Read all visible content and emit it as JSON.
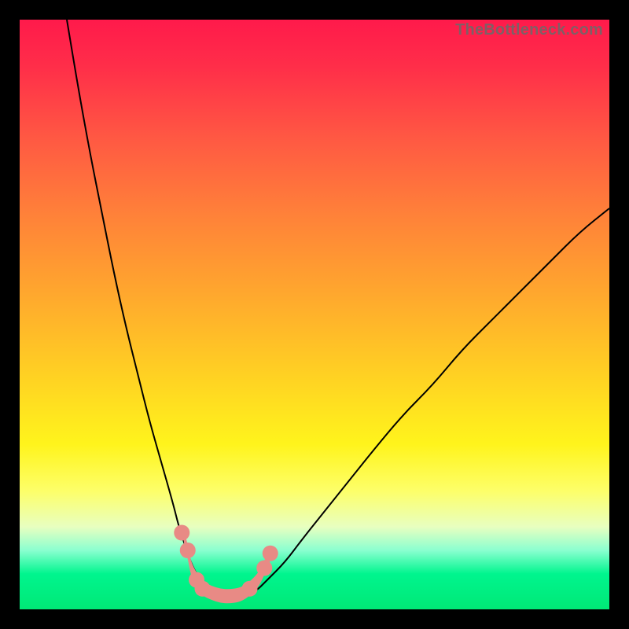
{
  "watermark": "TheBottleneck.com",
  "chart_data": {
    "type": "line",
    "title": "",
    "xlabel": "",
    "ylabel": "",
    "xlim": [
      0,
      100
    ],
    "ylim": [
      0,
      100
    ],
    "grid": false,
    "legend": false,
    "annotations": [],
    "series": [
      {
        "name": "left-curve",
        "x": [
          8,
          10,
          12,
          14,
          16,
          18,
          20,
          22,
          24,
          26,
          27,
          28,
          29,
          30,
          31,
          32
        ],
        "values": [
          100,
          88,
          77,
          67,
          57,
          48,
          40,
          32,
          25,
          18,
          14,
          11,
          8,
          6,
          4,
          3
        ]
      },
      {
        "name": "right-curve",
        "x": [
          40,
          42,
          45,
          48,
          52,
          56,
          60,
          65,
          70,
          75,
          80,
          85,
          90,
          95,
          100
        ],
        "values": [
          3,
          5,
          8,
          12,
          17,
          22,
          27,
          33,
          38,
          44,
          49,
          54,
          59,
          64,
          68
        ]
      },
      {
        "name": "bottom-trough",
        "x": [
          30,
          31,
          32,
          33,
          34,
          35,
          36,
          37,
          38,
          39,
          40
        ],
        "values": [
          6,
          4,
          3,
          2.5,
          2,
          1.8,
          2,
          2.2,
          2.5,
          3,
          4
        ]
      }
    ],
    "markers": {
      "note": "salmon-colored lumpy markers near the trough",
      "points": [
        {
          "x": 27.5,
          "y": 13
        },
        {
          "x": 28.5,
          "y": 10
        },
        {
          "x": 29,
          "y": 7
        },
        {
          "x": 30,
          "y": 5
        },
        {
          "x": 31,
          "y": 3.5
        },
        {
          "x": 32.5,
          "y": 2.8
        },
        {
          "x": 34,
          "y": 2.3
        },
        {
          "x": 35.5,
          "y": 2.2
        },
        {
          "x": 37,
          "y": 2.4
        },
        {
          "x": 38,
          "y": 2.8
        },
        {
          "x": 39,
          "y": 3.5
        },
        {
          "x": 40.5,
          "y": 5
        },
        {
          "x": 41.5,
          "y": 7
        },
        {
          "x": 42.5,
          "y": 9.5
        }
      ]
    }
  }
}
